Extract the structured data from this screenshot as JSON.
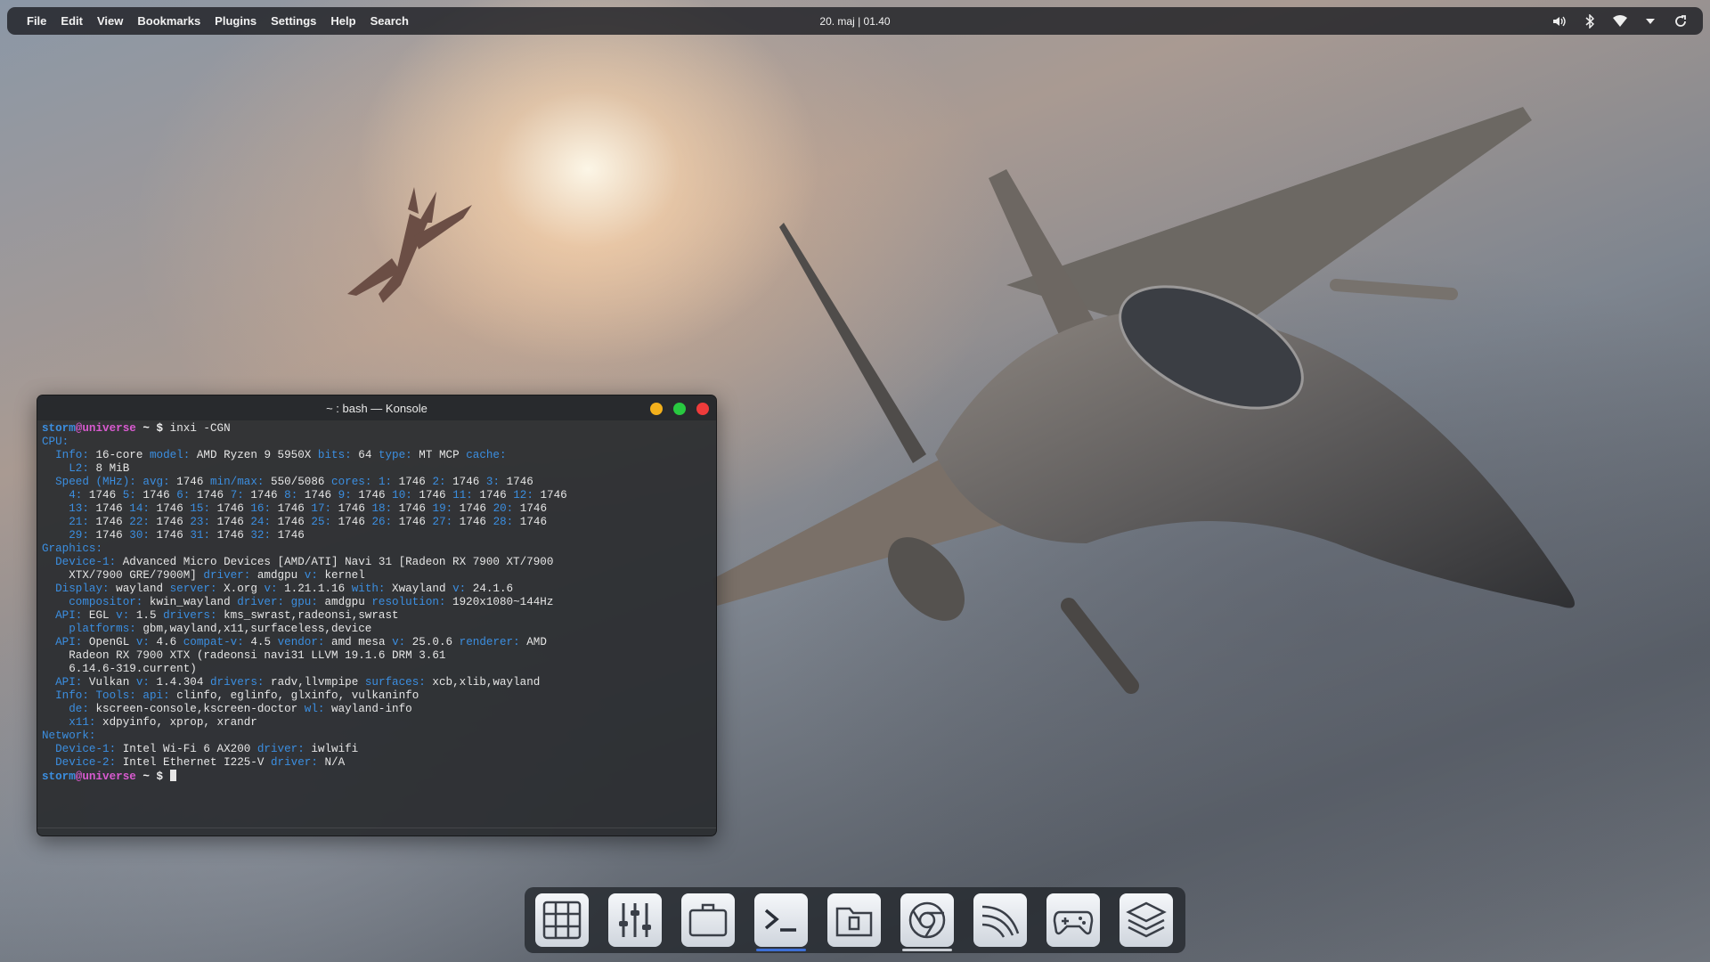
{
  "menubar": {
    "items": [
      "File",
      "Edit",
      "View",
      "Bookmarks",
      "Plugins",
      "Settings",
      "Help",
      "Search"
    ],
    "clock": "20. maj | 01.40",
    "tray": [
      "volume-icon",
      "bluetooth-icon",
      "wifi-icon",
      "chevron-down-icon",
      "refresh-icon"
    ]
  },
  "konsole": {
    "title": "~ : bash — Konsole",
    "user": "storm",
    "host": "universe",
    "command": "inxi -CGN"
  },
  "dock": {
    "items": [
      {
        "name": "app-grid-icon",
        "active": false,
        "indicator": ""
      },
      {
        "name": "mixer-icon",
        "active": false,
        "indicator": ""
      },
      {
        "name": "briefcase-icon",
        "active": false,
        "indicator": ""
      },
      {
        "name": "terminal-icon",
        "active": true,
        "indicator": "#3d6fd6"
      },
      {
        "name": "files-icon",
        "active": false,
        "indicator": ""
      },
      {
        "name": "chrome-icon",
        "active": true,
        "indicator": "#c8ccd2"
      },
      {
        "name": "wave-icon",
        "active": false,
        "indicator": ""
      },
      {
        "name": "gamepad-icon",
        "active": false,
        "indicator": ""
      },
      {
        "name": "layers-icon",
        "active": false,
        "indicator": ""
      }
    ]
  },
  "colors": {
    "window_bg": "#2a2c2f",
    "key": "#3b8ee0",
    "host": "#d95ad0",
    "minimize": "#f3b01c",
    "maximize": "#28c840",
    "close": "#ee3b3b"
  }
}
